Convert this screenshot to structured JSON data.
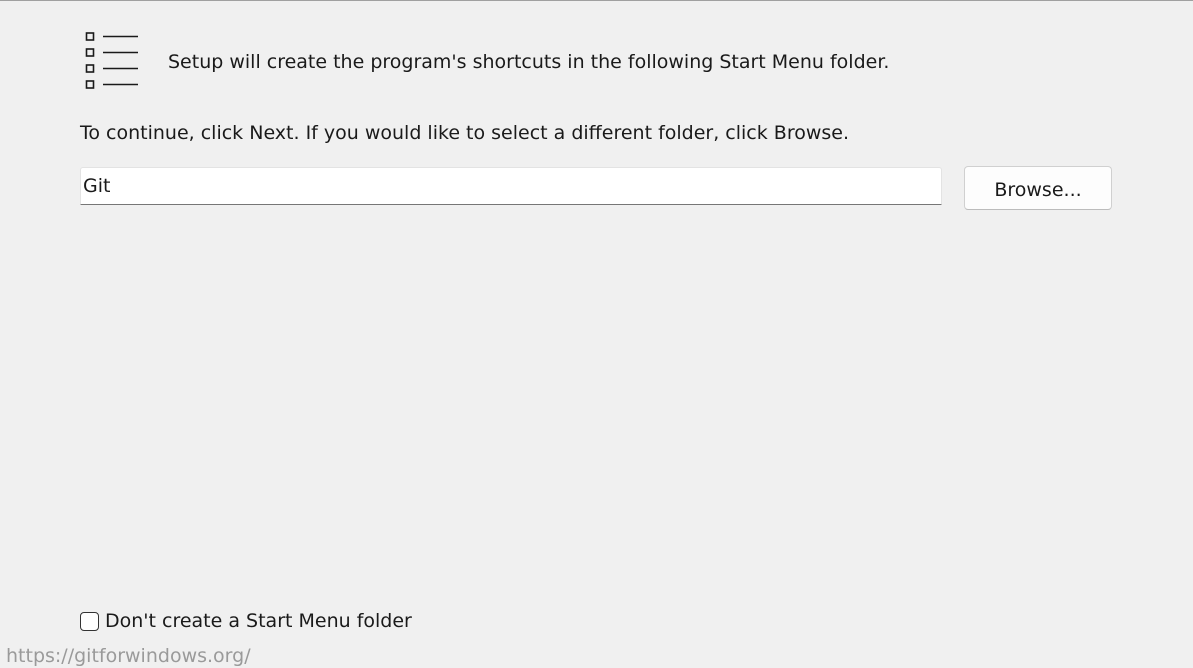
{
  "header": {
    "icon": "list-icon",
    "intro_text": "Setup will create the program's shortcuts in the following Start Menu folder."
  },
  "main": {
    "instruction_text": "To continue, click Next. If you would like to select a different folder, click Browse.",
    "folder_input_value": "Git",
    "browse_label": "Browse..."
  },
  "options": {
    "no_start_menu_checked": false,
    "no_start_menu_label": "Don't create a Start Menu folder"
  },
  "footer": {
    "link_text": "https://gitforwindows.org/"
  }
}
